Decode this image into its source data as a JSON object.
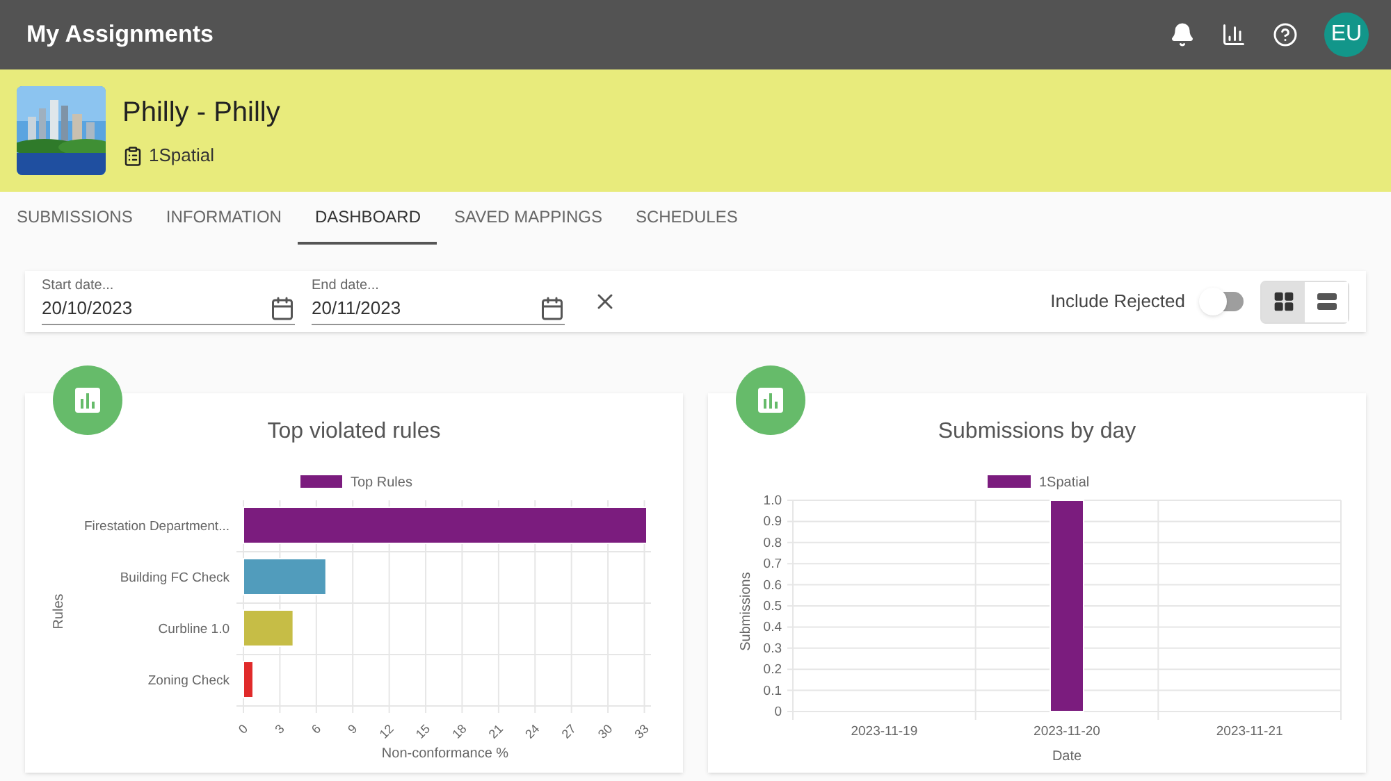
{
  "app_bar": {
    "title": "My Assignments",
    "avatar": "EU"
  },
  "project": {
    "name": "Philly - Philly",
    "organisation": "1Spatial"
  },
  "tabs": [
    {
      "label": "SUBMISSIONS",
      "selected": false
    },
    {
      "label": "INFORMATION",
      "selected": false
    },
    {
      "label": "DASHBOARD",
      "selected": true
    },
    {
      "label": "SAVED MAPPINGS",
      "selected": false
    },
    {
      "label": "SCHEDULES",
      "selected": false
    }
  ],
  "filters": {
    "start_date": {
      "label": "Start date...",
      "value": "20/10/2023"
    },
    "end_date": {
      "label": "End date...",
      "value": "20/11/2023"
    },
    "include_rejected": {
      "label": "Include Rejected",
      "on": false
    },
    "view_modes": [
      {
        "kind": "grid",
        "selected": true
      },
      {
        "kind": "list",
        "selected": false
      }
    ]
  },
  "cards": [
    {
      "title": "Top violated rules",
      "chart_data": {
        "type": "bar",
        "orientation": "horizontal",
        "xlabel": "Non-conformance %",
        "ylabel": "Rules",
        "categories": [
          "Firestation Department...",
          "Building FC Check",
          "Curbline 1.0",
          "Zoning Check"
        ],
        "series": [
          {
            "name": "Top Rules",
            "color": "#7b1c7e",
            "colors": [
              "#7b1c7e",
              "#519cbc",
              "#c6bd46",
              "#e02a2a"
            ],
            "values": [
              33.2,
              6.8,
              4.1,
              0.8
            ]
          }
        ],
        "grid": true,
        "xlim": [
          0,
          33.2
        ],
        "xticks": [
          0,
          3,
          6,
          9,
          12,
          15,
          18,
          21,
          24,
          27,
          30,
          33
        ]
      }
    },
    {
      "title": "Submissions by day",
      "chart_data": {
        "type": "bar",
        "xlabel": "Date",
        "ylabel": "Submissions",
        "categories": [
          "2023-11-19",
          "2023-11-20",
          "2023-11-21"
        ],
        "series": [
          {
            "name": "1Spatial",
            "color": "#7b1c7e",
            "values": [
              0,
              1,
              0
            ]
          }
        ],
        "grid": true,
        "ylim": [
          0,
          1
        ],
        "yticks": [
          {
            "value": 0,
            "label": "0"
          },
          0.1,
          0.2,
          0.3,
          0.4,
          0.5,
          0.6,
          0.7,
          0.8,
          0.9,
          {
            "value": 1,
            "label": "1.0"
          }
        ]
      }
    }
  ]
}
